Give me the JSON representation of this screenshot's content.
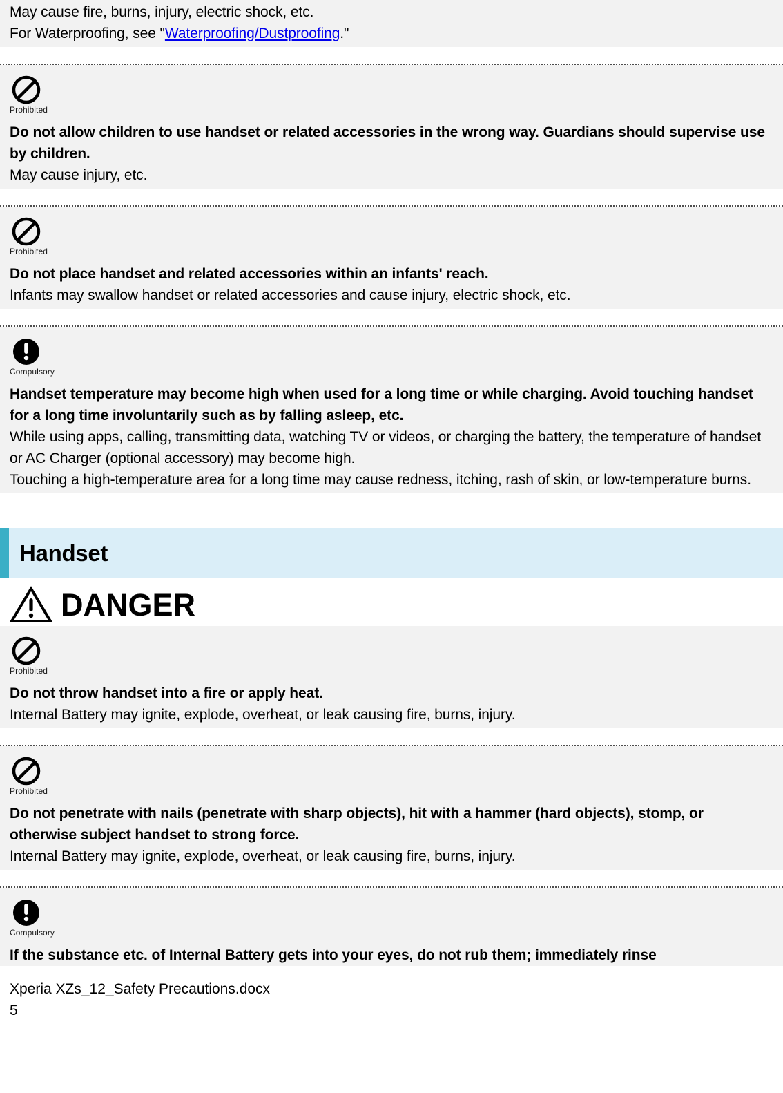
{
  "document": {
    "top_paragraph": {
      "line1": "May cause fire, burns, injury, electric shock, etc.",
      "line2_prefix": "For Waterproofing, see \"",
      "line2_link": "Waterproofing/Dustproofing",
      "line2_suffix": ".\""
    },
    "blocks": [
      {
        "icon": "prohibited-icon",
        "icon_caption": "Prohibited",
        "heading": "Do not allow children to use handset or related accessories in the wrong way. Guardians should supervise use by children.",
        "body": [
          "May cause injury, etc."
        ]
      },
      {
        "icon": "prohibited-icon",
        "icon_caption": "Prohibited",
        "heading": "Do not place handset and related accessories within an infants' reach.",
        "body": [
          "Infants may swallow handset or related accessories and cause injury, electric shock, etc."
        ]
      },
      {
        "icon": "compulsory-icon",
        "icon_caption": "Compulsory",
        "heading": "Handset temperature may become high when used for a long time or while charging. Avoid touching handset for a long time involuntarily such as by falling asleep, etc.",
        "body": [
          "While using apps, calling, transmitting data, watching TV or videos, or charging the battery, the temperature of handset or AC Charger (optional accessory) may become high.",
          "Touching a high-temperature area for a long time may cause redness, itching, rash of skin, or low-temperature burns."
        ]
      }
    ],
    "section": {
      "title": "Handset",
      "accent_color": "#3aafc6",
      "band_color": "#daeef8"
    },
    "danger": {
      "label": "DANGER",
      "icon": "warning-triangle-icon"
    },
    "danger_blocks": [
      {
        "icon": "prohibited-icon",
        "icon_caption": "Prohibited",
        "heading": "Do not throw handset into a fire or apply heat.",
        "body": [
          "Internal Battery may ignite, explode, overheat, or leak causing fire, burns, injury."
        ]
      },
      {
        "icon": "prohibited-icon",
        "icon_caption": "Prohibited",
        "heading": "Do not penetrate with nails (penetrate with sharp objects), hit with a hammer (hard objects), stomp, or otherwise subject handset to strong force.",
        "body": [
          "Internal Battery may ignite, explode, overheat, or leak causing fire, burns, injury."
        ]
      },
      {
        "icon": "compulsory-icon",
        "icon_caption": "Compulsory",
        "heading": "If the substance etc. of Internal Battery gets into your eyes, do not rub them; immediately rinse",
        "body": []
      }
    ],
    "footer": {
      "filename": "Xperia XZs_12_Safety Precautions.docx",
      "page_number": "5"
    }
  }
}
